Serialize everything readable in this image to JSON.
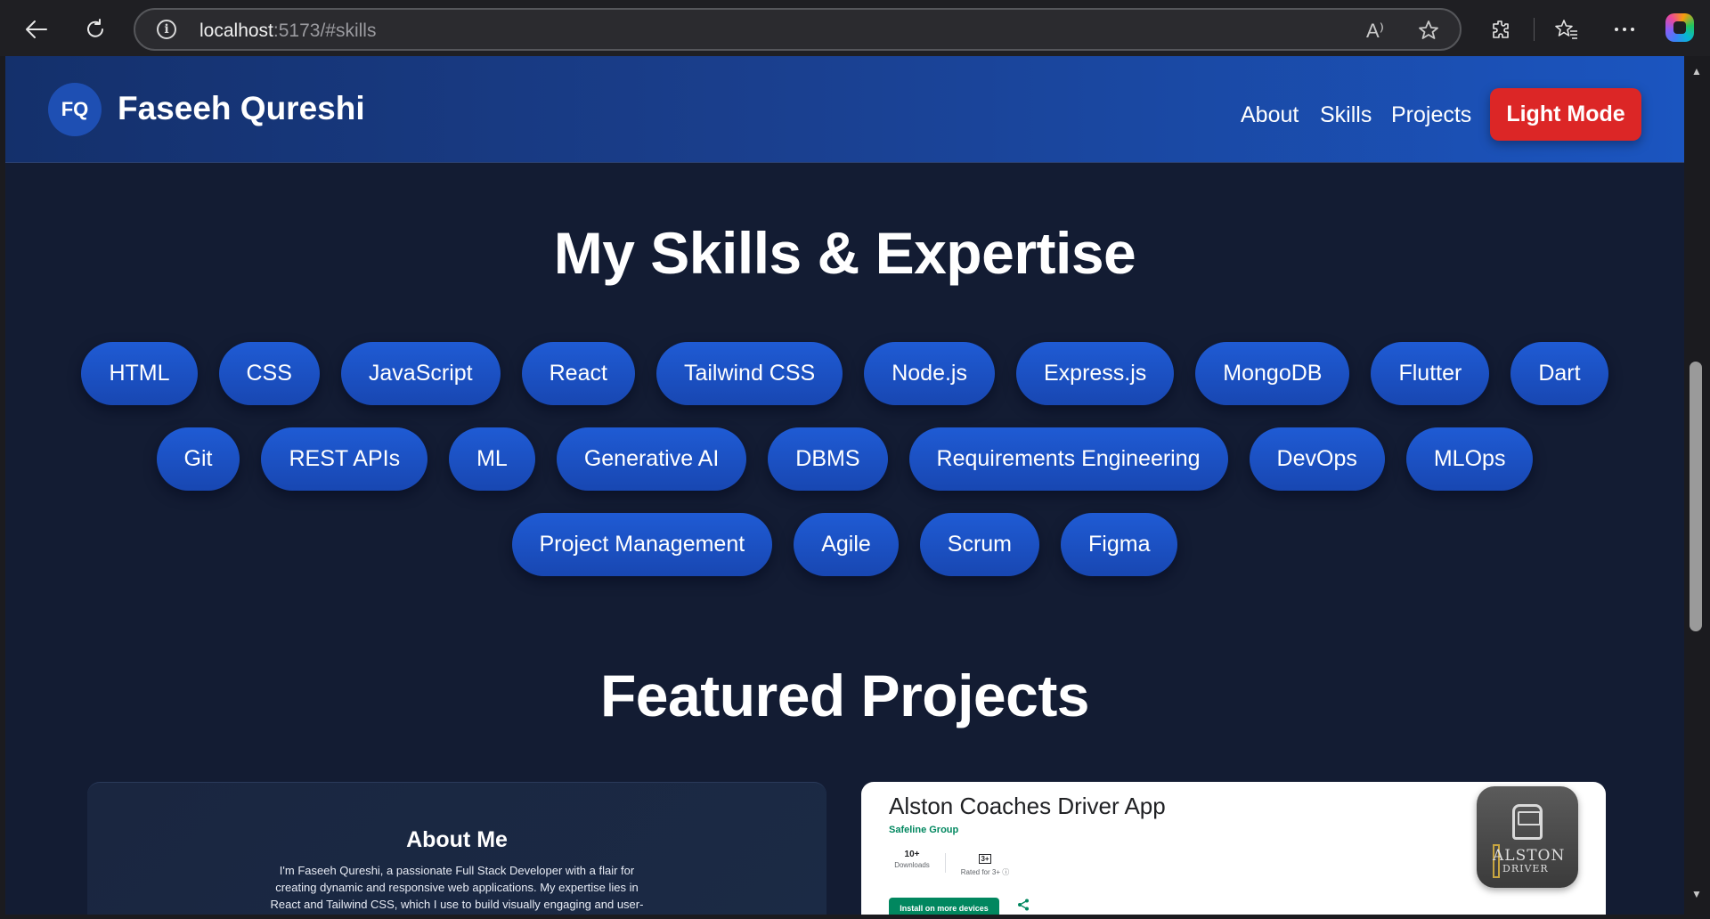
{
  "browser": {
    "url_host": "localhost",
    "url_path": ":5173/#skills",
    "read_aloud_glyph": "A⁾"
  },
  "navbar": {
    "logo": "FQ",
    "brand": "Faseeh Qureshi",
    "links": [
      "About",
      "Skills",
      "Projects"
    ],
    "theme_button": "Light Mode"
  },
  "skills": {
    "title": "My Skills & Expertise",
    "rows": [
      [
        "HTML",
        "CSS",
        "JavaScript",
        "React",
        "Tailwind CSS",
        "Node.js",
        "Express.js",
        "MongoDB",
        "Flutter",
        "Dart"
      ],
      [
        "Git",
        "REST APIs",
        "ML",
        "Generative AI",
        "DBMS",
        "Requirements Engineering",
        "DevOps",
        "MLOps"
      ],
      [
        "Project Management",
        "Agile",
        "Scrum",
        "Figma"
      ]
    ]
  },
  "projects": {
    "title": "Featured Projects",
    "about_card": {
      "heading": "About Me",
      "text": "I'm Faseeh Qureshi, a passionate Full Stack Developer with a flair for creating dynamic and responsive web applications. My expertise lies in React and Tailwind CSS, which I use to build visually engaging and user-friendly interfaces."
    },
    "app_card": {
      "title": "Alston Coaches Driver App",
      "developer": "Safeline Group",
      "downloads_value": "10+",
      "downloads_label": "Downloads",
      "rating_value": "3+",
      "rating_label": "Rated for 3+ ⓘ",
      "install_label": "Install on more devices",
      "icon_text_1": "ALSTON",
      "icon_text_2": "DRIVER"
    }
  },
  "colors": {
    "page_bg": "#131c33",
    "navbar_start": "#14306b",
    "navbar_end": "#1b55c0",
    "pill": "#1f5bd4",
    "theme_button": "#dc2626",
    "play_green": "#01875f"
  }
}
